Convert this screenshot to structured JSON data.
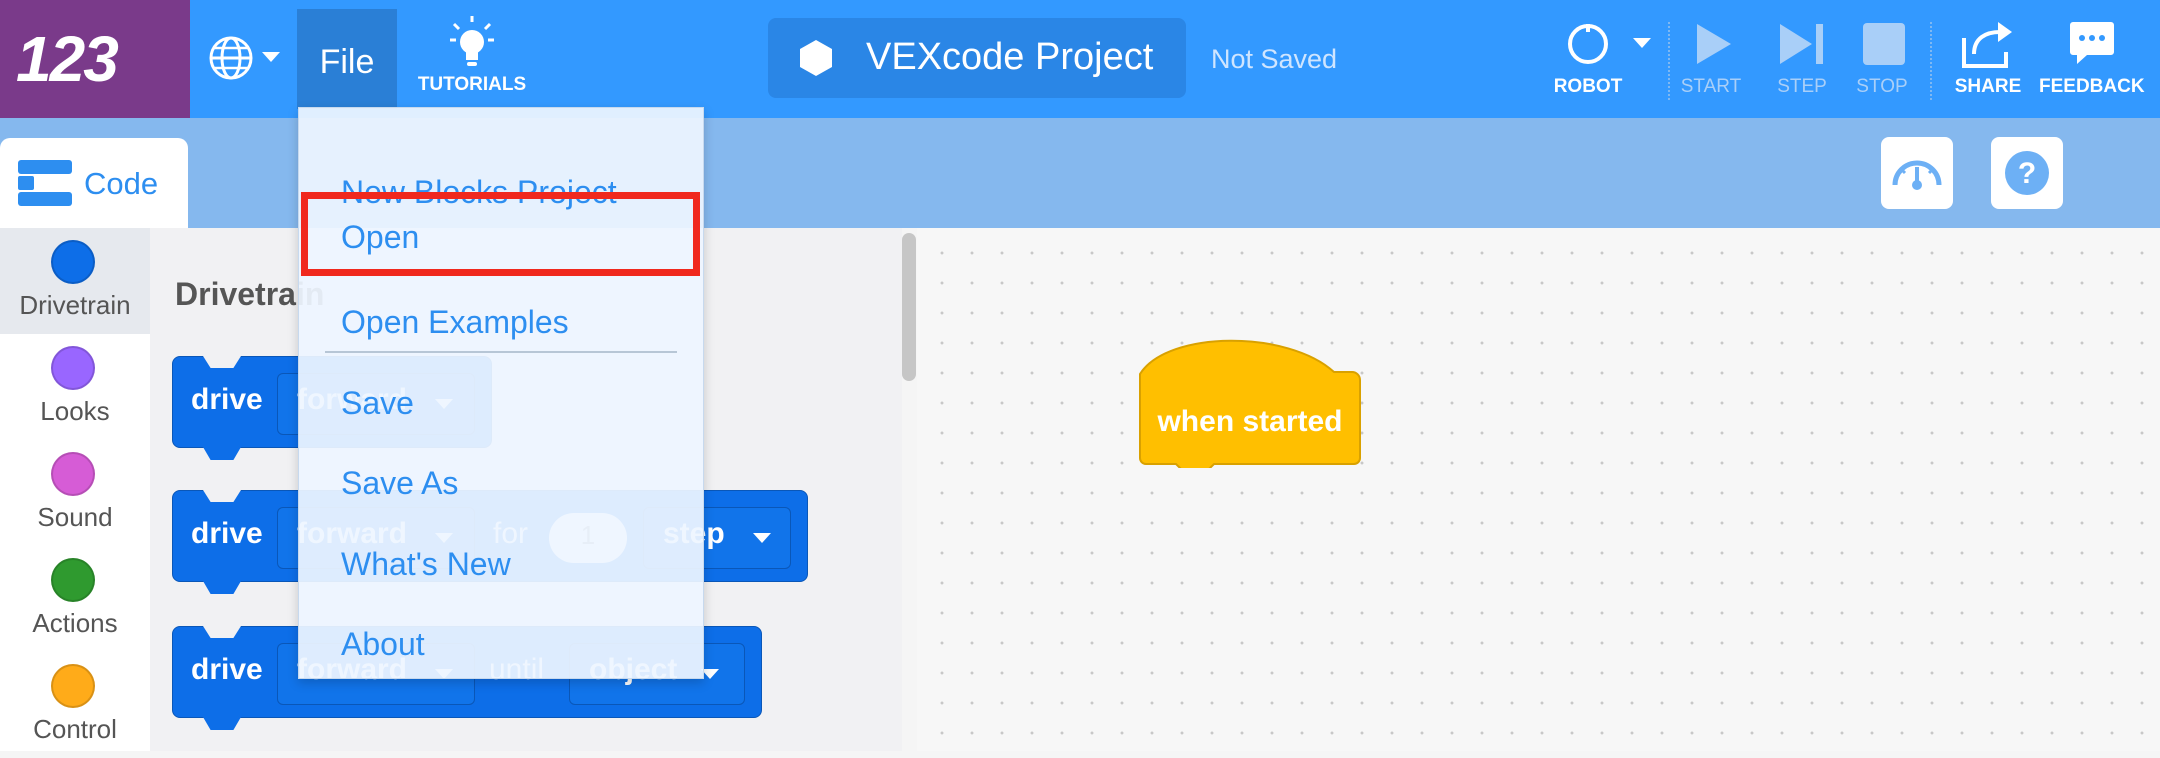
{
  "topbar": {
    "logo_text": "123",
    "file_label": "File",
    "tutorials_label": "TUTORIALS",
    "project_title": "VEXcode Project",
    "save_status": "Not Saved",
    "robot_label": "ROBOT",
    "start_label": "START",
    "step_label": "STEP",
    "stop_label": "STOP",
    "share_label": "SHARE",
    "feedback_label": "FEEDBACK"
  },
  "subbar": {
    "code_tab_label": "Code",
    "dashboard_icon": "speedometer-icon",
    "help_icon": "question-icon"
  },
  "categories": [
    {
      "label": "Drivetrain",
      "color": "#0d6ee8",
      "active": true
    },
    {
      "label": "Looks",
      "color": "#9966ff"
    },
    {
      "label": "Sound",
      "color": "#d65cd6"
    },
    {
      "label": "Actions",
      "color": "#2f9a2f"
    },
    {
      "label": "Control",
      "color": "#ffab19"
    }
  ],
  "flyout": {
    "title": "Drivetrain",
    "blocks": [
      {
        "keyword": "drive",
        "dropdown": "forward"
      },
      {
        "keyword": "drive",
        "dropdown": "forward",
        "for_label": "for",
        "amount": "1",
        "unit": "step"
      },
      {
        "keyword": "drive",
        "dropdown": "forward",
        "until_label": "until",
        "target": "object"
      }
    ]
  },
  "workspace": {
    "hat_block_label": "when started",
    "hat_color": "#ffbf00"
  },
  "file_menu": {
    "items": [
      {
        "label": "New Blocks Project"
      },
      {
        "label": "Open",
        "highlighted": true
      },
      {
        "label": "Open Examples"
      },
      {
        "label": "Save"
      },
      {
        "label": "Save As"
      },
      {
        "label": "What's New"
      },
      {
        "label": "About"
      }
    ]
  },
  "colors": {
    "topbar": "#3399ff",
    "logo_bg": "#7a3a8a",
    "accent": "#2d8ef0",
    "highlight_border": "#f0281e"
  }
}
